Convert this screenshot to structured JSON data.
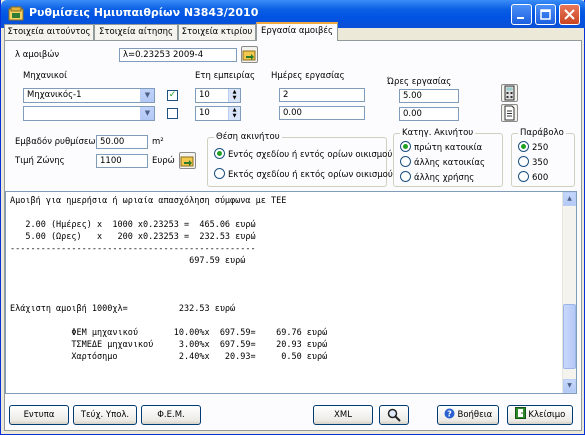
{
  "window": {
    "title": "Ρυθμίσεις Ημιυπαιθρίων Ν3843/2010"
  },
  "tabs": [
    "Στοιχεία αιτούντος",
    "Στοιχεία αίτησης",
    "Στοιχεία κτιρίου",
    "Εργασία αμοιβές"
  ],
  "fee": {
    "label": "λ αμοιβών",
    "value": "λ=0.23253 2009-4"
  },
  "engineers": {
    "label": "Μηχανικοί",
    "years_label": "Ετη εμπειρίας",
    "days_label": "Ημέρες εργασίας",
    "hours_label": "Ώρες εργασίας",
    "rows": [
      {
        "name": "Μηχανικός-1",
        "checked": "✓",
        "years": "10",
        "days": "2",
        "hours": "5.00"
      },
      {
        "name": "",
        "checked": "",
        "years": "10",
        "days": "0.00",
        "hours": "0.00"
      }
    ]
  },
  "area": {
    "label": "Εμβαδόν ρυθμίσεων",
    "value": "50.00",
    "unit": "m²"
  },
  "zone": {
    "label": "Τιμή Ζώνης",
    "value": "1100",
    "unit": "Ευρώ"
  },
  "location": {
    "title": "Θέση ακινήτου",
    "options": [
      "Εντός σχεδίου ή εντός ορίων οικισμού",
      "Εκτός σχεδίου ή εκτός ορίων οικισμού"
    ],
    "selected": 0
  },
  "category": {
    "title": "Κατηγ. Ακινήτου",
    "options": [
      "πρώτη κατοικία",
      "άλλης κατοικίας",
      "άλλης χρήσης"
    ],
    "selected": 0
  },
  "parabolo": {
    "title": "Παράβολο",
    "options": [
      "250",
      "350",
      "600"
    ],
    "selected": 0
  },
  "output_text": "Αμοιβή για ημερήσια ή ωριαία απασχόληση σύμφωνα με ΤΕΕ\n\n   2.00 (Ημέρες) x  1000 x0.23253 =  465.06 ευρώ\n   5.00 (Ωρες)   x   200 x0.23253 =  232.53 ευρώ\n------------------------------------------------\n                                   697.59 ευρώ\n\n\n\nΕλάχιστη αμοιβή 1000χλ=          232.53 ευρώ\n\n            ΦΕΜ μηχανικού       10.00%x  697.59=    69.76 ευρώ\n            ΤΣΜΕΔΕ μηχανικού     3.00%x  697.59=    20.93 ευρώ\n            Χαρτόσημο            2.40%x   20.93=     0.50 ευρώ",
  "buttons": {
    "print": "Εντυπα",
    "tech": "Τεύχ. Υπολ.",
    "fem": "Φ.Ε.Μ.",
    "xml": "XML",
    "help": "Βοήθεια",
    "close": "Κλείσιμο"
  },
  "colors": {
    "titlebar": "#0054e3",
    "tab_highlight": "#f0a840",
    "check_green": "#21a121"
  }
}
